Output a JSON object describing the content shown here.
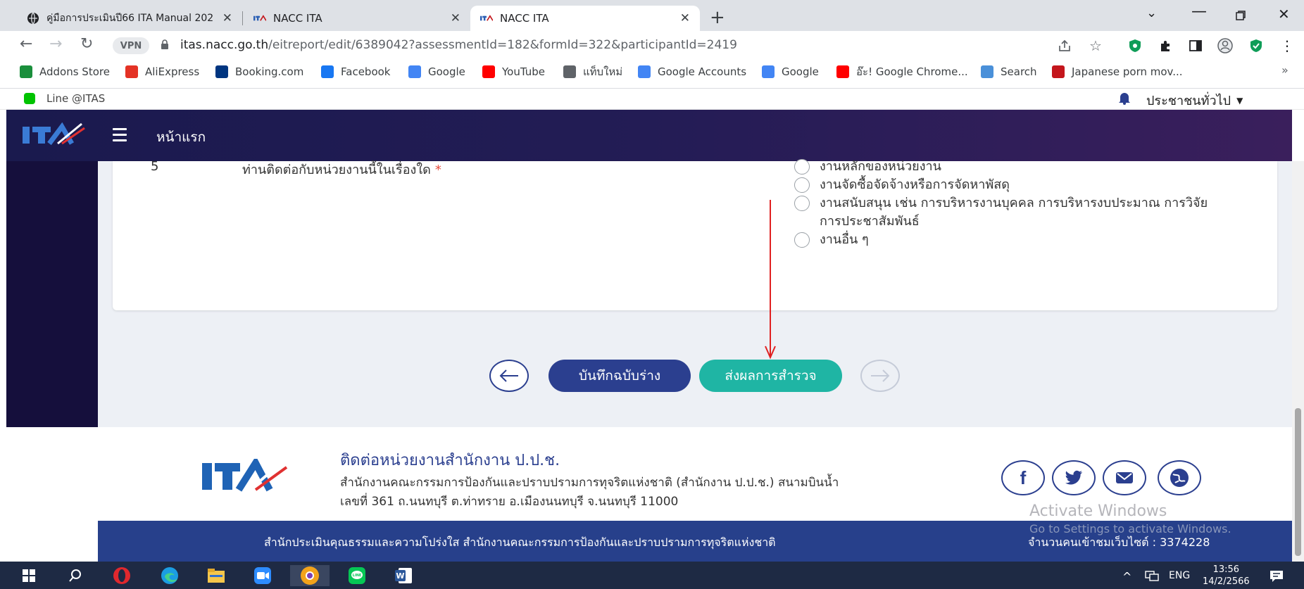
{
  "browser": {
    "tabs": [
      {
        "title": "คู่มือการประเมินปี66 ITA Manual 202",
        "favicon": "globe-icon"
      },
      {
        "title": "NACC ITA",
        "favicon": "ita-logo"
      },
      {
        "title": "NACC ITA",
        "favicon": "ita-logo"
      }
    ],
    "new_tab": "+",
    "vpn_label": "VPN",
    "url_host": "itas.nacc.go.th",
    "url_path": "/eitreport/edit/6389042?assessmentId=182&formId=322&participantId=2419"
  },
  "bookmarks": [
    {
      "label": "Addons Store",
      "icon": "opera-addons-icon",
      "color": "#1a8f3c"
    },
    {
      "label": "AliExpress",
      "icon": "aliexpress-icon",
      "color": "#e43225"
    },
    {
      "label": "Booking.com",
      "icon": "booking-icon",
      "color": "#003580"
    },
    {
      "label": "Facebook",
      "icon": "facebook-icon",
      "color": "#1877f2"
    },
    {
      "label": "Google",
      "icon": "google-icon",
      "color": "#4285f4"
    },
    {
      "label": "YouTube",
      "icon": "youtube-icon",
      "color": "#ff0000"
    },
    {
      "label": "แท็บใหม่",
      "icon": "globe-icon",
      "color": "#5f6368"
    },
    {
      "label": "Google Accounts",
      "icon": "google-icon",
      "color": "#4285f4"
    },
    {
      "label": "Google",
      "icon": "google-icon",
      "color": "#4285f4"
    },
    {
      "label": "อ๊ะ! Google Chrome...",
      "icon": "youtube-icon",
      "color": "#ff0000"
    },
    {
      "label": "Search",
      "icon": "search-app-icon",
      "color": "#4a90d9"
    },
    {
      "label": "Japanese porn mov...",
      "icon": "r-icon",
      "color": "#c4161c"
    }
  ],
  "bookmarks_more": "»",
  "site": {
    "line_label": "Line @ITAS",
    "user_role": "ประชาชนทั่วไป",
    "nav_home": "หน้าแรก"
  },
  "question": {
    "number": "5",
    "text": "ท่านติดต่อกับหน่วยงานนี้ในเรื่องใด",
    "required_mark": "*",
    "options": [
      "งานหลักของหน่วยงาน",
      "งานจัดซื้อจัดจ้างหรือการจัดหาพัสดุ",
      "งานสนับสนุน เช่น การบริหารงานบุคคล การบริหารงบประมาณ การวิจัย การประชาสัมพันธ์",
      "งานอื่น ๆ"
    ]
  },
  "actions": {
    "save_draft": "บันทึกฉบับร่าง",
    "submit": "ส่งผลการสำรวจ"
  },
  "footer": {
    "contact_title": "ติดต่อหน่วยงานสำนักงาน ป.ป.ช.",
    "address_line1": "สำนักงานคณะกรรมการป้องกันและปราบปรามการทุจริตแห่งชาติ (สำนักงาน ป.ป.ช.) สนามบินน้ำ",
    "address_line2": "เลขที่ 361 ถ.นนทบุรี ต.ท่าทราย อ.เมืองนนทบุรี จ.นนทบุรี 11000",
    "bottom_text": "สำนักประเมินคุณธรรมและความโปร่งใส สำนักงานคณะกรรมการป้องกันและปราบปรามการทุจริตแห่งชาติ",
    "visitor_count": "จำนวนคนเข้าชมเว็บไซต์ : 3374228",
    "social": [
      "facebook-icon",
      "twitter-icon",
      "mail-icon",
      "web-icon"
    ]
  },
  "watermark": {
    "line1": "Activate Windows",
    "line2": "Go to Settings to activate Windows."
  },
  "taskbar": {
    "lang": "ENG",
    "time": "13:56",
    "date": "14/2/2566"
  },
  "colors": {
    "primary": "#2b3f8f",
    "submit": "#1fb5a4",
    "nav": "#1a1a4e",
    "required": "#e74c3c"
  }
}
